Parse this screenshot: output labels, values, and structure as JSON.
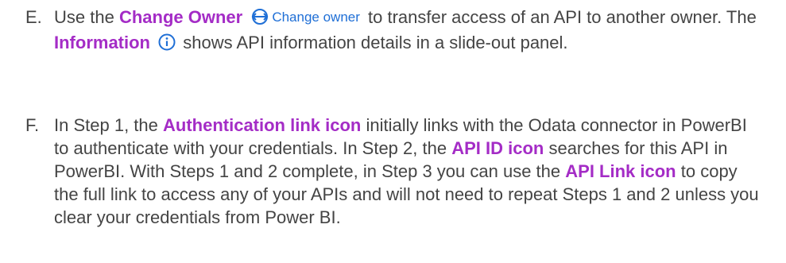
{
  "items": [
    {
      "marker": "E.",
      "pre1": "Use the",
      "hl1": "Change Owner",
      "icon1": "change-owner-icon",
      "chip": "Change owner",
      "post1": "to transfer access of an API to another owner. The",
      "hl2": "Information",
      "icon2": "info-icon",
      "post2": "shows API information details in a slide-out panel."
    },
    {
      "marker": "F.",
      "t1": "In Step 1, the",
      "h1": "Authentication link icon",
      "t2": "initially links with the Odata connector in PowerBI to authenticate with your credentials. In Step 2, the",
      "h2": "API ID icon",
      "t3": "searches for this API in PowerBI. With Steps 1 and 2 complete, in Step 3 you can use the",
      "h3": "API Link icon",
      "t4": "to copy the full link to access any of your APIs and will not need to repeat Steps 1 and 2 unless you clear your credentials from Power BI."
    }
  ],
  "colors": {
    "highlight": "#a42cc6",
    "body_text": "#444444",
    "link_blue": "#1f6fd6"
  }
}
